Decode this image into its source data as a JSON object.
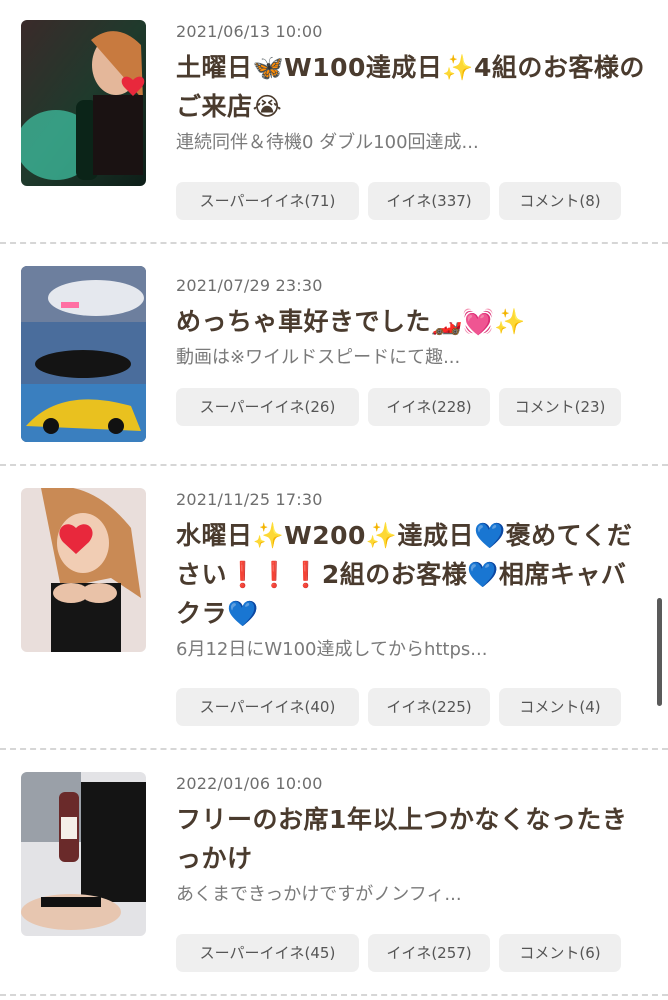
{
  "posts": [
    {
      "date": "2021/06/13 10:00",
      "title": "土曜日🦋W100達成日✨4組のお客様のご来店😭",
      "excerpt": "連続同伴＆待機0 ダブル100回達成...",
      "buttons": {
        "super_like": "スーパーイイネ(71)",
        "like": "イイネ(337)",
        "comment": "コメント(8)"
      }
    },
    {
      "date": "2021/07/29 23:30",
      "title": "めっちゃ車好きでした🏎️💓✨",
      "excerpt": "動画は※ワイルドスピードにて趣...",
      "buttons": {
        "super_like": "スーパーイイネ(26)",
        "like": "イイネ(228)",
        "comment": "コメント(23)"
      }
    },
    {
      "date": "2021/11/25 17:30",
      "title": "水曜日✨W200✨達成日💙褒めてください❗❗❗2組のお客様💙相席キャバクラ💙",
      "excerpt": "6月12日にW100達成してからhttps...",
      "buttons": {
        "super_like": "スーパーイイネ(40)",
        "like": "イイネ(225)",
        "comment": "コメント(4)"
      }
    },
    {
      "date": "2022/01/06 10:00",
      "title": "フリーのお席1年以上つかなくなったきっかけ",
      "excerpt": "あくまできっかけですがノンフィ...",
      "buttons": {
        "super_like": "スーパーイイネ(45)",
        "like": "イイネ(257)",
        "comment": "コメント(6)"
      }
    }
  ],
  "icons": [
    "heart-sticker-icon"
  ],
  "colors": {
    "title": "#4a3b2e",
    "date": "#6e6e6e",
    "button_bg": "#efefef",
    "divider": "#d6d6d6",
    "heart": "#e8283c"
  }
}
